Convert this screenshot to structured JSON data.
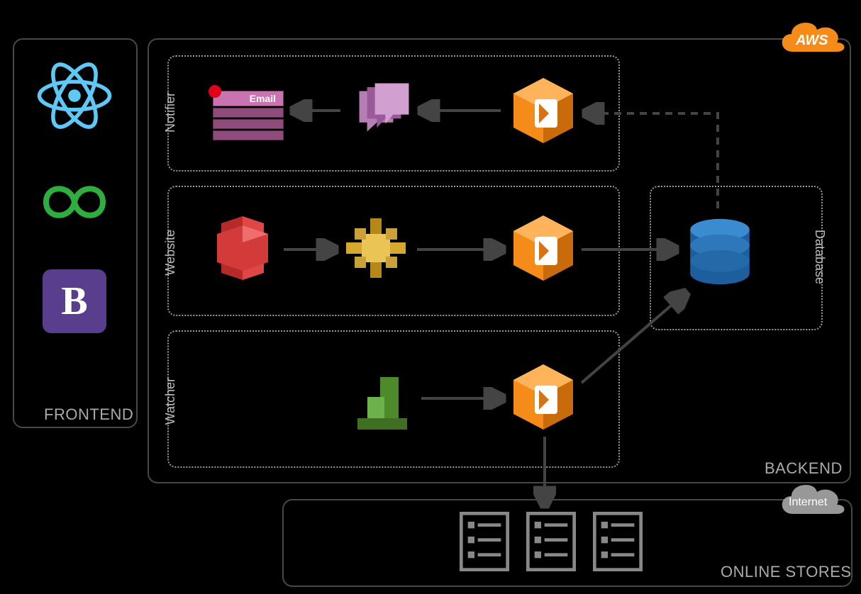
{
  "panels": {
    "frontend": "FRONTEND",
    "backend": "BACKEND",
    "online_stores": "ONLINE STORES"
  },
  "subgroups": {
    "notifier": "Notifier",
    "website": "Website",
    "watcher": "Watcher",
    "database": "Database"
  },
  "clouds": {
    "aws": "AWS",
    "internet": "Internet"
  },
  "icons": {
    "react": "react-logo",
    "infinity": "infinity-logo",
    "bootstrap": "B",
    "email_badge": "Email",
    "sns": "sns-icon",
    "lambda_notifier": "lambda-icon",
    "s3": "s3-icon",
    "api_gateway": "slack-block-icon",
    "lambda_website": "lambda-icon",
    "dynamodb": "dynamodb-icon",
    "cloudwatch": "cloudwatch-icon",
    "lambda_watcher": "lambda-icon",
    "store1": "list-icon",
    "store2": "list-icon",
    "store3": "list-icon"
  }
}
